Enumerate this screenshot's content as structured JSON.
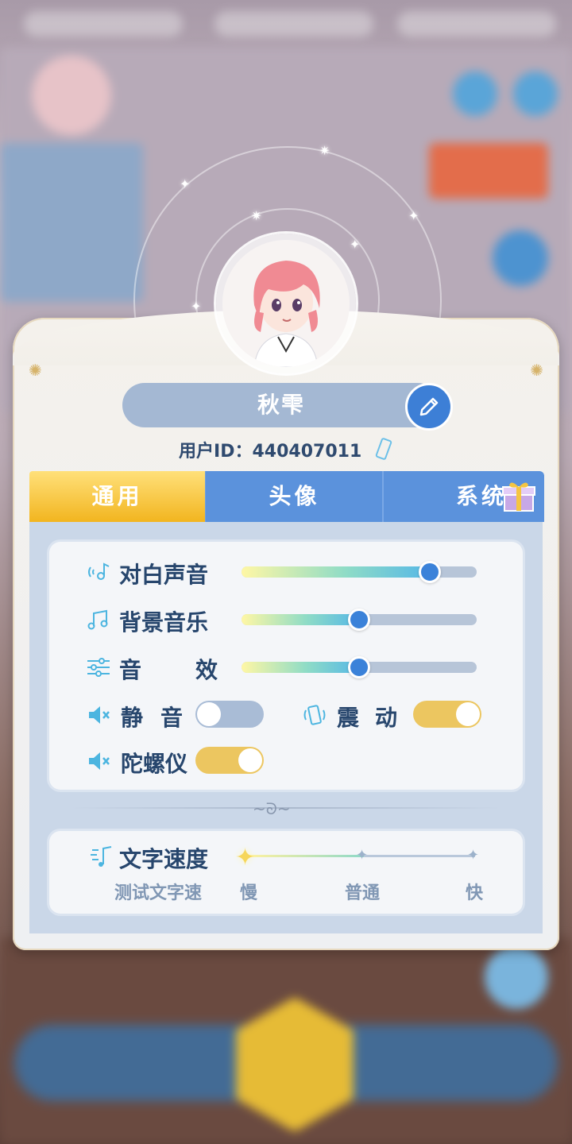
{
  "profile": {
    "name": "秋雫",
    "uid_label": "用户ID：",
    "uid_value": "440407011"
  },
  "tabs": [
    {
      "label": "通用",
      "active": true
    },
    {
      "label": "头像",
      "active": false
    },
    {
      "label": "系统",
      "active": false
    }
  ],
  "settings": {
    "dialogue_voice": {
      "label": "对白声音",
      "value": 0.8
    },
    "bgm": {
      "label": "背景音乐",
      "value": 0.5
    },
    "sfx": {
      "label_a": "音",
      "label_b": "效",
      "value": 0.5
    },
    "mute": {
      "label_a": "静",
      "label_b": "音",
      "on": false
    },
    "vibration": {
      "label_a": "震",
      "label_b": "动",
      "on": true
    },
    "gyroscope": {
      "label": "陀螺仪",
      "on": true
    }
  },
  "text_speed": {
    "label": "文字速度",
    "preview": "测试文字速",
    "slow": "慢",
    "normal": "普通",
    "fast": "快",
    "value": "慢"
  },
  "colors": {
    "accent_blue": "#3b82d9",
    "tab_active": "#f2b51f",
    "tab_inactive": "#5b92dc",
    "toggle_on": "#ecc660",
    "toggle_off": "#a9bcd6"
  },
  "icons": [
    "edit-pencil-icon",
    "copy-icon",
    "gift-icon",
    "voice-icon",
    "music-note-icon",
    "equalizer-icon",
    "speaker-mute-icon",
    "vibration-icon",
    "text-speed-icon"
  ]
}
